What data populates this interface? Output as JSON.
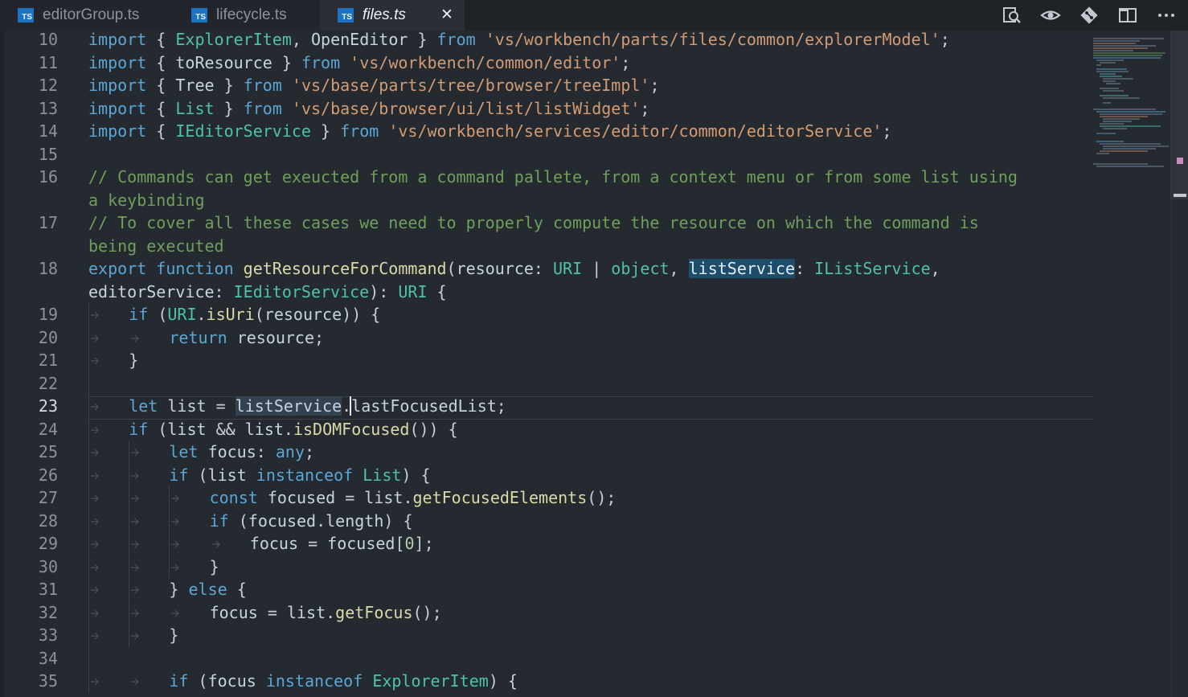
{
  "tabs": [
    {
      "label": "editorGroup.ts",
      "badge": "TS",
      "active": false
    },
    {
      "label": "lifecycle.ts",
      "badge": "TS",
      "active": false
    },
    {
      "label": "files.ts",
      "badge": "TS",
      "active": true
    }
  ],
  "close_glyph": "✕",
  "toolbar": [
    "find-in-files-icon",
    "open-changes-icon",
    "git-compare-icon",
    "split-editor-icon",
    "more-actions-icon"
  ],
  "editor": {
    "current_line": 23,
    "lines": [
      {
        "n": 10,
        "text": "import { ExplorerItem, OpenEditor } from 'vs/workbench/parts/files/common/explorerModel';"
      },
      {
        "n": 11,
        "text": "import { toResource } from 'vs/workbench/common/editor';"
      },
      {
        "n": 12,
        "text": "import { Tree } from 'vs/base/parts/tree/browser/treeImpl';"
      },
      {
        "n": 13,
        "text": "import { List } from 'vs/base/browser/ui/list/listWidget';"
      },
      {
        "n": 14,
        "text": "import { IEditorService } from 'vs/workbench/services/editor/common/editorService';"
      },
      {
        "n": 15,
        "text": ""
      },
      {
        "n": 16,
        "text": "// Commands can get exeucted from a command pallete, from a context menu or from some list using",
        "cont": "a keybinding"
      },
      {
        "n": 17,
        "text": "// To cover all these cases we need to properly compute the resource on which the command is",
        "cont": "being executed"
      },
      {
        "n": 18,
        "text": "export function getResourceForCommand(resource: URI | object, listService: IListService,",
        "cont": "editorService: IEditorService): URI {"
      },
      {
        "n": 19,
        "text": "if (URI.isUri(resource)) {"
      },
      {
        "n": 20,
        "text": "return resource;"
      },
      {
        "n": 21,
        "text": "}"
      },
      {
        "n": 22,
        "text": ""
      },
      {
        "n": 23,
        "text": "let list = listService.lastFocusedList;"
      },
      {
        "n": 24,
        "text": "if (list && list.isDOMFocused()) {"
      },
      {
        "n": 25,
        "text": "let focus: any;"
      },
      {
        "n": 26,
        "text": "if (list instanceof List) {"
      },
      {
        "n": 27,
        "text": "const focused = list.getFocusedElements();"
      },
      {
        "n": 28,
        "text": "if (focused.length) {"
      },
      {
        "n": 29,
        "text": "focus = focused[0];"
      },
      {
        "n": 30,
        "text": "}"
      },
      {
        "n": 31,
        "text": "} else {"
      },
      {
        "n": 32,
        "text": "focus = list.getFocus();"
      },
      {
        "n": 33,
        "text": "}"
      },
      {
        "n": 34,
        "text": ""
      },
      {
        "n": 35,
        "text": "if (focus instanceof ExplorerItem) {"
      }
    ]
  },
  "colors": {
    "background": "#252a31",
    "keyword": "#5aa7d6",
    "type": "#4fc1a6",
    "string": "#d49b73",
    "comment": "#6f9f5b",
    "selection": "#1e4c6b"
  }
}
